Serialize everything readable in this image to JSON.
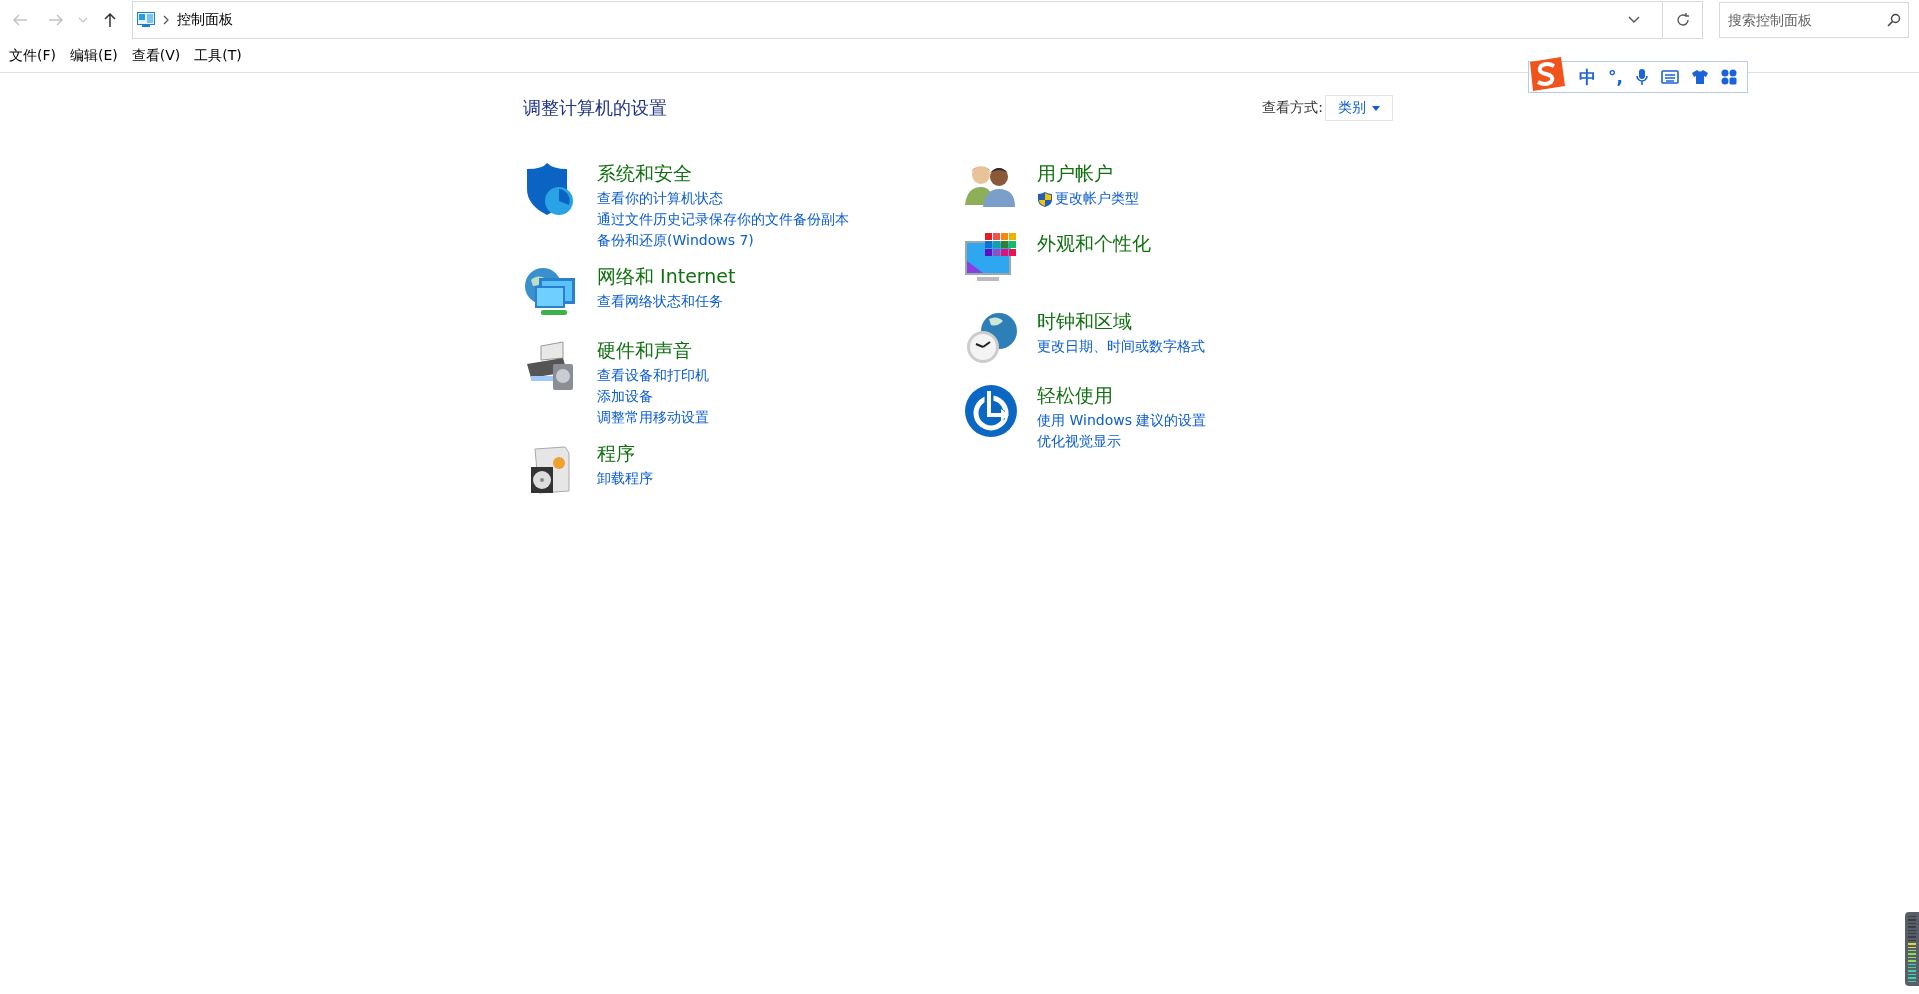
{
  "nav": {
    "back": {
      "disabled": true
    },
    "forward": {
      "disabled": true
    },
    "up": {
      "disabled": false
    }
  },
  "address": {
    "path": "控制面板"
  },
  "search": {
    "placeholder": "搜索控制面板"
  },
  "menu": [
    "文件(F)",
    "编辑(E)",
    "查看(V)",
    "工具(T)"
  ],
  "heading": "调整计算机的设置",
  "view_by": {
    "label": "查看方式:",
    "value": "类别"
  },
  "ime": {
    "mode": "中",
    "punct": "°,"
  },
  "columns": [
    {
      "categories": [
        {
          "kind": "security",
          "title": "系统和安全",
          "links": [
            {
              "text": "查看你的计算机状态"
            },
            {
              "text": "通过文件历史记录保存你的文件备份副本"
            },
            {
              "text": "备份和还原(Windows 7)"
            }
          ]
        },
        {
          "kind": "network",
          "title": "网络和 Internet",
          "links": [
            {
              "text": "查看网络状态和任务"
            }
          ]
        },
        {
          "kind": "hardware",
          "title": "硬件和声音",
          "links": [
            {
              "text": "查看设备和打印机"
            },
            {
              "text": "添加设备"
            },
            {
              "text": "调整常用移动设置"
            }
          ]
        },
        {
          "kind": "programs",
          "title": "程序",
          "links": [
            {
              "text": "卸载程序"
            }
          ]
        }
      ]
    },
    {
      "categories": [
        {
          "kind": "users",
          "title": "用户帐户",
          "links": [
            {
              "text": "更改帐户类型",
              "shield": true
            }
          ]
        },
        {
          "kind": "appearance",
          "title": "外观和个性化"
        },
        {
          "kind": "clock",
          "title": "时钟和区域",
          "links": [
            {
              "text": "更改日期、时间或数字格式"
            }
          ]
        },
        {
          "kind": "ease",
          "title": "轻松使用",
          "links": [
            {
              "text": "使用 Windows 建议的设置"
            },
            {
              "text": "优化视觉显示"
            }
          ]
        }
      ]
    }
  ],
  "meter": {
    "level": 0.6
  }
}
